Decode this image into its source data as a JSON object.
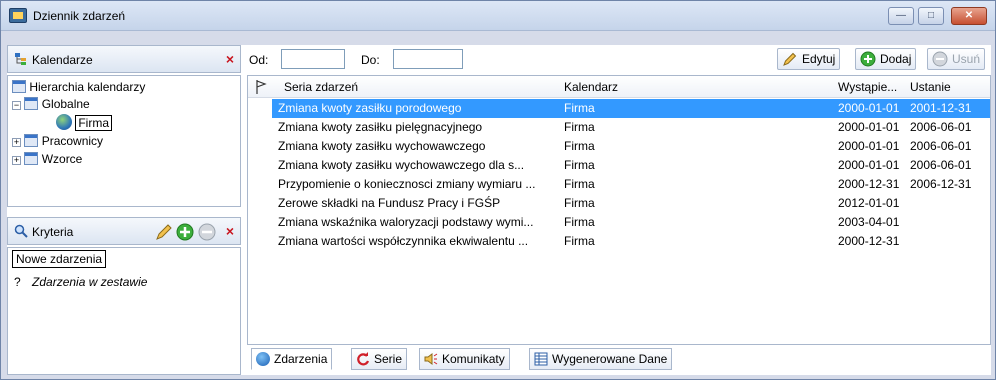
{
  "window": {
    "title": "Dziennik zdarzeń",
    "minimize_label": "—",
    "maximize_label": "□",
    "close_label": "✕"
  },
  "calendars_panel": {
    "title": "Kalendarze",
    "close_label": "×",
    "tree": {
      "root": "Hierarchia kalendarzy",
      "globalne": "Globalne",
      "firma": "Firma",
      "pracownicy": "Pracownicy",
      "wzorce": "Wzorce",
      "expand_minus": "−",
      "expand_plus": "+"
    }
  },
  "criteria_panel": {
    "title": "Kryteria",
    "close_label": "×",
    "new_events_label": "Nowe zdarzenia",
    "item_marker": "?",
    "item_text": "Zdarzenia w zestawie"
  },
  "filter": {
    "od_label": "Od:",
    "do_label": "Do:",
    "od_value": "",
    "do_value": ""
  },
  "toolbar": {
    "edit_label": "Edytuj",
    "add_label": "Dodaj",
    "remove_label": "Usuń"
  },
  "table": {
    "columns": [
      "Seria zdarzeń",
      "Kalendarz",
      "Wystąpie...",
      "Ustanie"
    ],
    "rows": [
      {
        "name": "Zmiana kwoty zasiłku porodowego",
        "calendar": "Firma",
        "start": "2000-01-01",
        "end": "2001-12-31"
      },
      {
        "name": "Zmiana kwoty zasiłku pielęgnacyjnego",
        "calendar": "Firma",
        "start": "2000-01-01",
        "end": "2006-06-01"
      },
      {
        "name": "Zmiana kwoty zasiłku wychowawczego",
        "calendar": "Firma",
        "start": "2000-01-01",
        "end": "2006-06-01"
      },
      {
        "name": "Zmiana kwoty zasiłku wychowawczego dla s...",
        "calendar": "Firma",
        "start": "2000-01-01",
        "end": "2006-06-01"
      },
      {
        "name": "Przypomienie o koniecznosci zmiany wymiaru ...",
        "calendar": "Firma",
        "start": "2000-12-31",
        "end": "2006-12-31"
      },
      {
        "name": "Zerowe składki na Fundusz Pracy i FGŚP",
        "calendar": "Firma",
        "start": "2012-01-01",
        "end": ""
      },
      {
        "name": "Zmiana wskaźnika waloryzacji podstawy wymi...",
        "calendar": "Firma",
        "start": "2003-04-01",
        "end": ""
      },
      {
        "name": "Zmiana wartości współczynnika ekwiwalentu ...",
        "calendar": "Firma",
        "start": "2000-12-31",
        "end": ""
      }
    ]
  },
  "tabs": [
    "Zdarzenia",
    "Serie",
    "Komunikaty",
    "Wygenerowane Dane"
  ],
  "colors": {
    "selection": "#3399ff",
    "accent_red": "#c8141e",
    "accent_green": "#3cae3c"
  }
}
